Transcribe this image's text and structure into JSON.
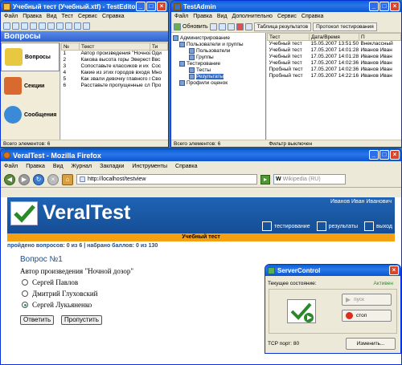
{
  "testeditor": {
    "title": "Учебный тест (Учебный.xtf) - TestEditor",
    "menu": [
      "Файл",
      "Правка",
      "Вид",
      "Тест",
      "Сервис",
      "Справка"
    ],
    "header": "Вопросы",
    "side_items": [
      "Вопросы",
      "Секции",
      "Сообщения"
    ],
    "columns": [
      "№",
      "Текст",
      "Ти"
    ],
    "rows": [
      [
        "1",
        "Автор произведения \"Ночной ...",
        "Оди"
      ],
      [
        "2",
        "Какова высота горы Эверест ...",
        "Ввс"
      ],
      [
        "3",
        "Сопоставьте классиков и их ...",
        "Сос"
      ],
      [
        "4",
        "Какие из этих городов входя...",
        "Мно"
      ],
      [
        "5",
        "Как звали девочку главного г...",
        "Сво"
      ],
      [
        "6",
        "Расставьте пропущенные сло...",
        "Про"
      ]
    ],
    "status": "Всего элементов: 6"
  },
  "testadmin": {
    "title": "TestAdmin",
    "menu": [
      "Файл",
      "Правка",
      "Вид",
      "Дополнительно",
      "Сервис",
      "Справка"
    ],
    "refresh": "Обновить",
    "tab_results": "Таблица результатов",
    "tab_protocol": "Протокол тестирования",
    "tree": [
      "Администрирование",
      "Пользователи и группы",
      "Пользователи",
      "Группы",
      "Тестирование",
      "Тесты",
      "Результаты",
      "Профили оценок"
    ],
    "columns": [
      "Тест",
      "Дата/Время",
      "П"
    ],
    "rows": [
      [
        "Учебный тест",
        "15.05.2007 13:51:50",
        "Внеклассный"
      ],
      [
        "Учебный тест",
        "17.05.2007 14:01:28",
        "Иванов Иван"
      ],
      [
        "Учебный тест",
        "17.05.2007 14:01:28",
        "Иванов Иван"
      ],
      [
        "Учебный тест",
        "17.05.2007 14:02:36",
        "Иванов Иван"
      ],
      [
        "Пробный тест",
        "17.05.2007 14:02:36",
        "Иванов Иван"
      ],
      [
        "Пробный тест",
        "17.05.2007 14:22:16",
        "Иванов Иван"
      ]
    ],
    "status": "Всего элементов: 6",
    "filter": "Фильтр выключен"
  },
  "firefox": {
    "title": "VeralTest - Mozilla Firefox",
    "menu": [
      "Файл",
      "Правка",
      "Вид",
      "Журнал",
      "Закладки",
      "Инструменты",
      "Справка"
    ],
    "url": "http://localhost/testview",
    "search_placeholder": "Wikipedia (RU)",
    "brand": "VeralTest",
    "user": "Иванов Иван Иванович",
    "nav": [
      "тестирование",
      "результаты",
      "выход"
    ],
    "test_name": "Учебный тест",
    "progress": "пройдено вопросов: 0 из 6 | набрано баллов: 0 из 130",
    "question_title": "Вопрос №1",
    "question_text": "Автор произведения \"Ночной дозор\"",
    "options": [
      "Сергей Павлов",
      "Дмитрий Глуховский",
      "Сергей Лукьяненко"
    ],
    "selected_option": 2,
    "answer_btn": "Ответить",
    "skip_btn": "Пропустить"
  },
  "servercontrol": {
    "title": "ServerControl",
    "state_label": "Текущее состояние:",
    "state_value": "Активен",
    "start": "пуск",
    "stop": "стоп",
    "port": "TCP порт: 80",
    "change": "Изменить..."
  }
}
